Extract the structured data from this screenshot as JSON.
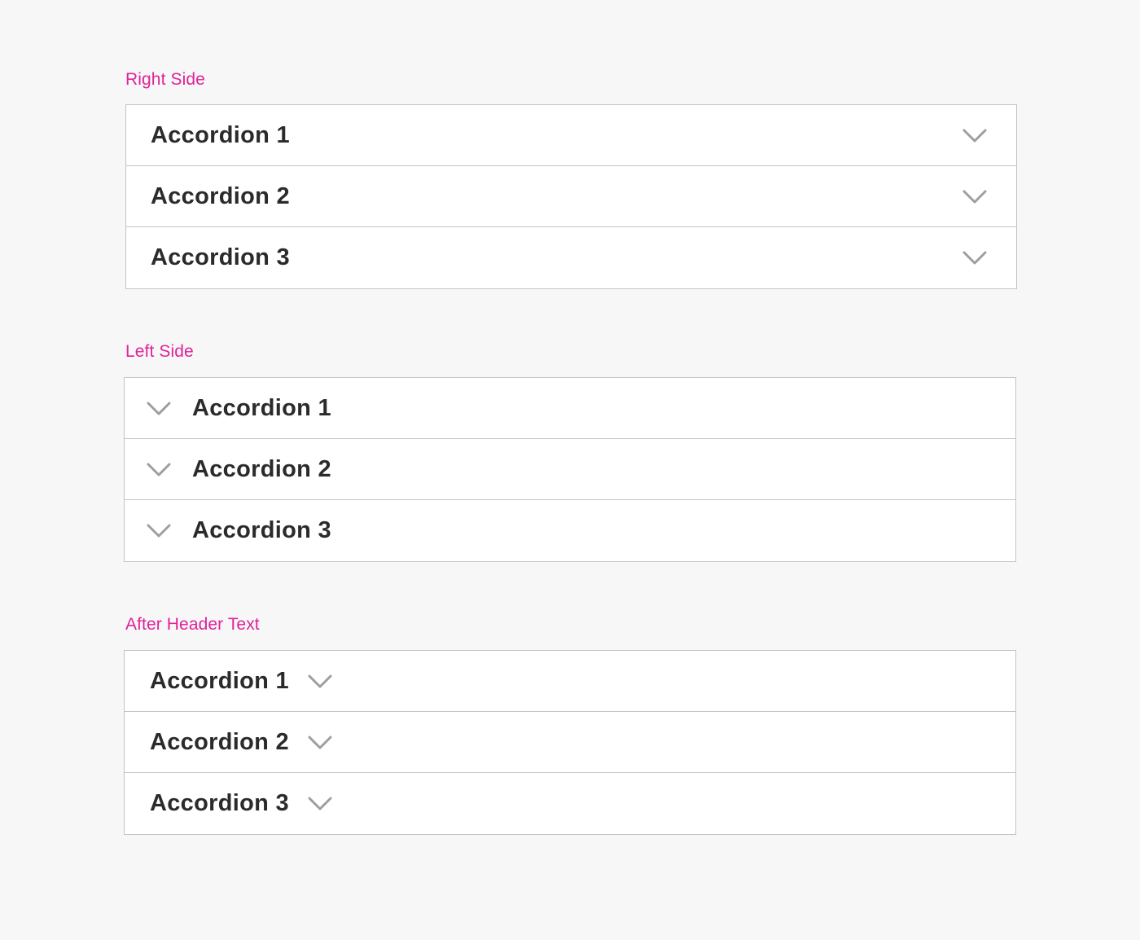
{
  "theme": {
    "label_color": "#e0229b",
    "text_color": "#2b2b2b",
    "chevron_color": "#9e9e9e",
    "border_color": "#c4c4c4",
    "background": "#f7f7f7"
  },
  "sections": [
    {
      "label": "Right Side",
      "icon": "chevron-down-icon",
      "items": [
        {
          "label": "Accordion 1"
        },
        {
          "label": "Accordion 2"
        },
        {
          "label": "Accordion 3"
        }
      ]
    },
    {
      "label": "Left Side",
      "icon": "chevron-down-icon",
      "items": [
        {
          "label": "Accordion 1"
        },
        {
          "label": "Accordion 2"
        },
        {
          "label": "Accordion 3"
        }
      ]
    },
    {
      "label": "After Header Text",
      "icon": "chevron-down-icon",
      "items": [
        {
          "label": "Accordion 1"
        },
        {
          "label": "Accordion 2"
        },
        {
          "label": "Accordion 3"
        }
      ]
    }
  ]
}
